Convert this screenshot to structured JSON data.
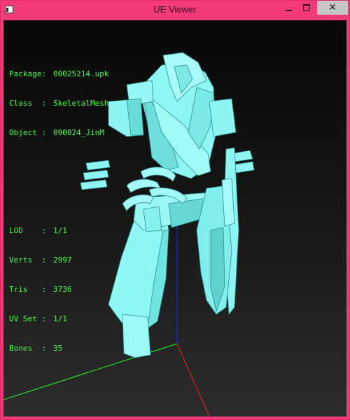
{
  "window": {
    "title": "UE Viewer",
    "close_glyph": "✕"
  },
  "info": {
    "object_rows": [
      {
        "label": "Package:",
        "value": "00025214.upk"
      },
      {
        "label": "Class  :",
        "value": "SkeletalMesh"
      },
      {
        "label": "Object :",
        "value": "090024_JinM"
      }
    ],
    "stats_rows": [
      {
        "label": "LOD    :",
        "value": "1/1"
      },
      {
        "label": "Verts  :",
        "value": "2997"
      },
      {
        "label": "Tris   :",
        "value": "3736"
      },
      {
        "label": "UV Set :",
        "value": "1/1"
      },
      {
        "label": "Bones  :",
        "value": "35"
      }
    ]
  },
  "colors": {
    "title_bar": "#f23a7a",
    "info_text": "#4aff4a",
    "mesh": "#7ff3f0",
    "axis_x": "#ff2020",
    "axis_y": "#20ff20",
    "axis_z": "#2020ff"
  },
  "icons": {
    "app": "app-icon",
    "minimize": "minimize-icon",
    "maximize": "maximize-icon",
    "close": "close-icon"
  }
}
